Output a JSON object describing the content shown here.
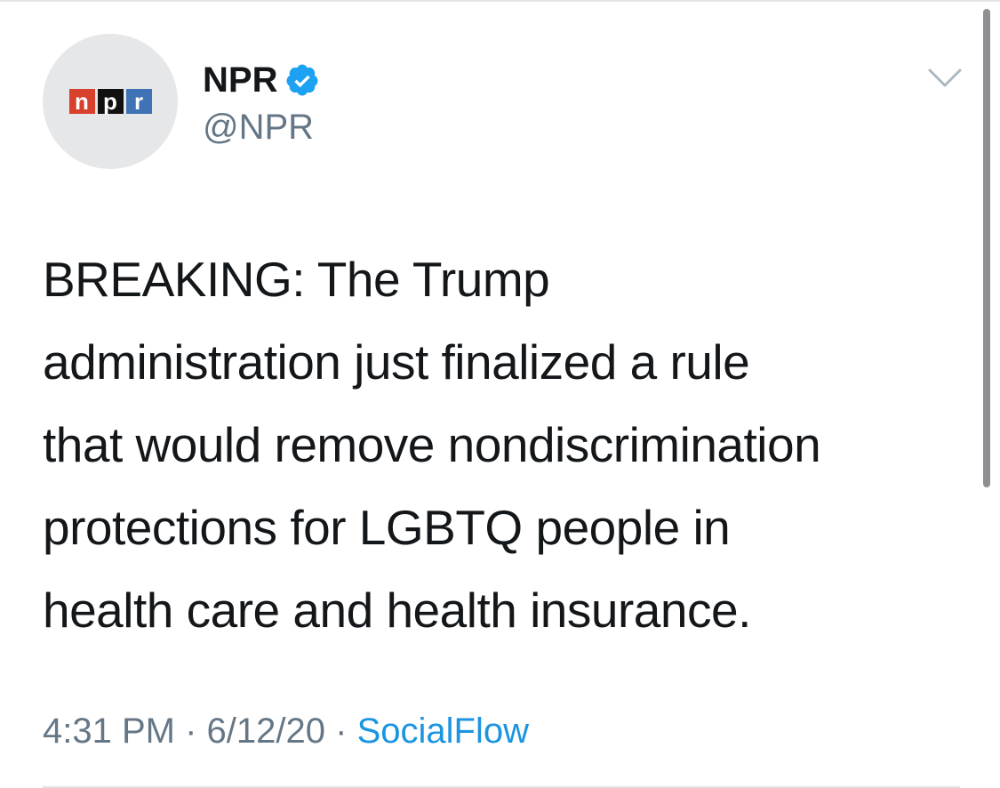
{
  "tweet": {
    "author": {
      "display_name": "NPR",
      "handle": "@NPR",
      "verified": true,
      "avatar_logo_letters": [
        "n",
        "p",
        "r"
      ]
    },
    "text_lines": [
      "BREAKING: The Trump",
      "administration just finalized a rule",
      "that would remove nondiscrimination",
      "protections for LGBTQ people in",
      "health care and health insurance."
    ],
    "time": "4:31 PM",
    "separator": "·",
    "date": "6/12/20",
    "source": "SocialFlow"
  },
  "colors": {
    "logo_n": "#d7412d",
    "logo_p": "#111111",
    "logo_r": "#3f73b6",
    "verified_badge": "#1da1f2",
    "muted_text": "#657786",
    "link": "#1b95e0"
  },
  "icons": {
    "menu": "chevron-down-icon",
    "badge": "verified-badge-icon"
  }
}
